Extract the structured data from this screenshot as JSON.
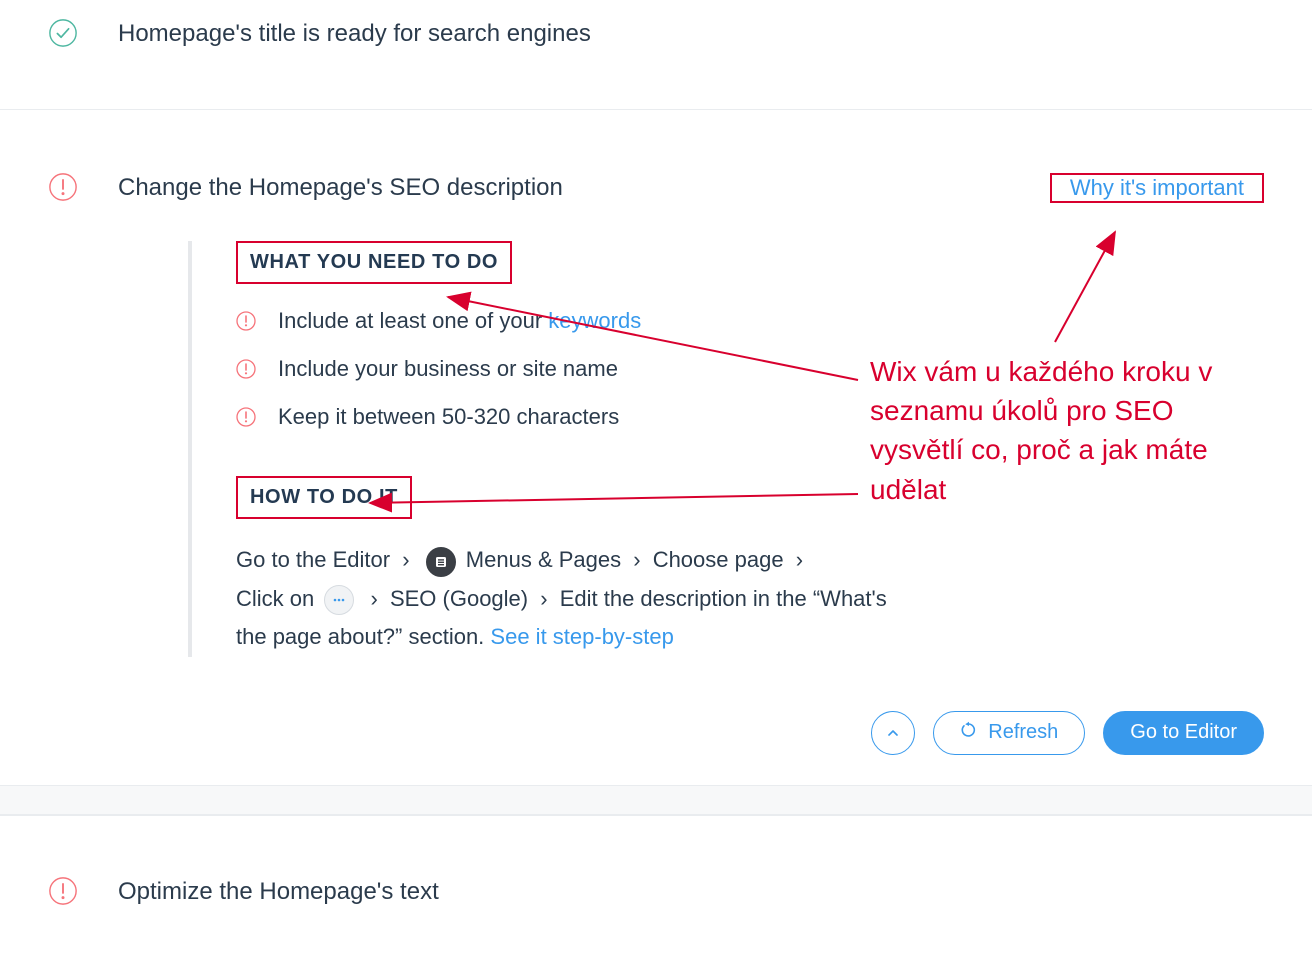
{
  "colors": {
    "accent": "#3899ec",
    "success": "#4eb7a1",
    "warn": "#f6747b",
    "annotation": "#d8002e",
    "text": "#2b3b4c"
  },
  "rows": {
    "top": {
      "title": "Homepage's title is ready for search engines",
      "status": "success"
    },
    "main": {
      "title": "Change the Homepage's SEO description",
      "status": "warn",
      "why_link": "Why it's important",
      "what_heading": "WHAT YOU NEED TO DO",
      "need_items": [
        {
          "prefix": "Include at least one of your ",
          "link": "keywords",
          "suffix": ""
        },
        {
          "prefix": "Include your business or site name",
          "link": "",
          "suffix": ""
        },
        {
          "prefix": "Keep it between 50-320 characters",
          "link": "",
          "suffix": ""
        }
      ],
      "how_heading": "HOW TO DO IT",
      "how": {
        "go_editor": "Go to the Editor",
        "menus_pages": "Menus & Pages",
        "choose_page": "Choose page",
        "click_on": "Click on",
        "seo_google": "SEO (Google)",
        "edit_desc": "Edit the description in the “What's the page about?” section.",
        "see_steps": "See it step-by-step",
        "chev": "›"
      }
    },
    "bottom": {
      "title": "Optimize the Homepage's text",
      "status": "warn"
    }
  },
  "actions": {
    "refresh": "Refresh",
    "go_editor": "Go to Editor"
  },
  "annotation": {
    "text": "Wix vám u každého kroku v seznamu úkolů pro SEO vysvětlí co, proč a jak máte udělat"
  }
}
